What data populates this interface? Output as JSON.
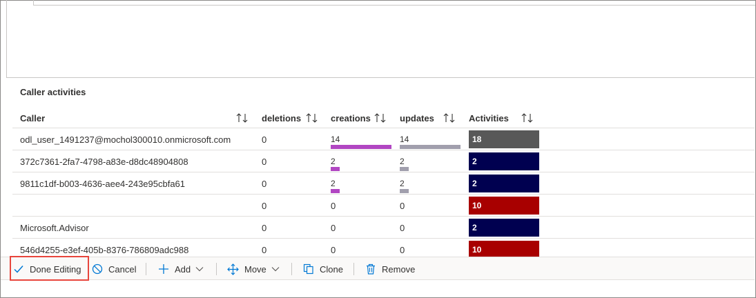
{
  "grid": {
    "title": "Caller activities",
    "columns": {
      "caller": "Caller",
      "deletions": "deletions",
      "creations": "creations",
      "updates": "updates",
      "activities": "Activities"
    },
    "rows": [
      {
        "caller": "odl_user_1491237@mochol300010.onmicrosoft.com",
        "deletions": "0",
        "creations": "14",
        "updates": "14",
        "activities": "18"
      },
      {
        "caller": "372c7361-2fa7-4798-a83e-d8dc48904808",
        "deletions": "0",
        "creations": "2",
        "updates": "2",
        "activities": "2"
      },
      {
        "caller": "9811c1df-b003-4636-aee4-243e95cbfa61",
        "deletions": "0",
        "creations": "2",
        "updates": "2",
        "activities": "2"
      },
      {
        "caller": "",
        "deletions": "0",
        "creations": "0",
        "updates": "0",
        "activities": "10"
      },
      {
        "caller": "Microsoft.Advisor",
        "deletions": "0",
        "creations": "0",
        "updates": "0",
        "activities": "2"
      },
      {
        "caller": "546d4255-e3ef-405b-8376-786809adc988",
        "deletions": "0",
        "creations": "0",
        "updates": "0",
        "activities": "10"
      }
    ],
    "bar_colors": {
      "creations": "#b146c2",
      "updates": "#a19fad"
    },
    "activity_colors": [
      "#585858",
      "#000050",
      "#000050",
      "#a80000",
      "#000050",
      "#a80000"
    ]
  },
  "toolbar": {
    "done_editing": "Done Editing",
    "cancel": "Cancel",
    "add": "Add",
    "move": "Move",
    "clone": "Clone",
    "remove": "Remove",
    "done_editing_icon": "checkmark-icon",
    "cancel_icon": "cancel-circle-icon",
    "add_icon": "plus-icon",
    "move_icon": "move-arrows-icon",
    "clone_icon": "clone-icon",
    "remove_icon": "trash-icon",
    "accent": "#0078d4",
    "highlight": "#e8453c"
  }
}
